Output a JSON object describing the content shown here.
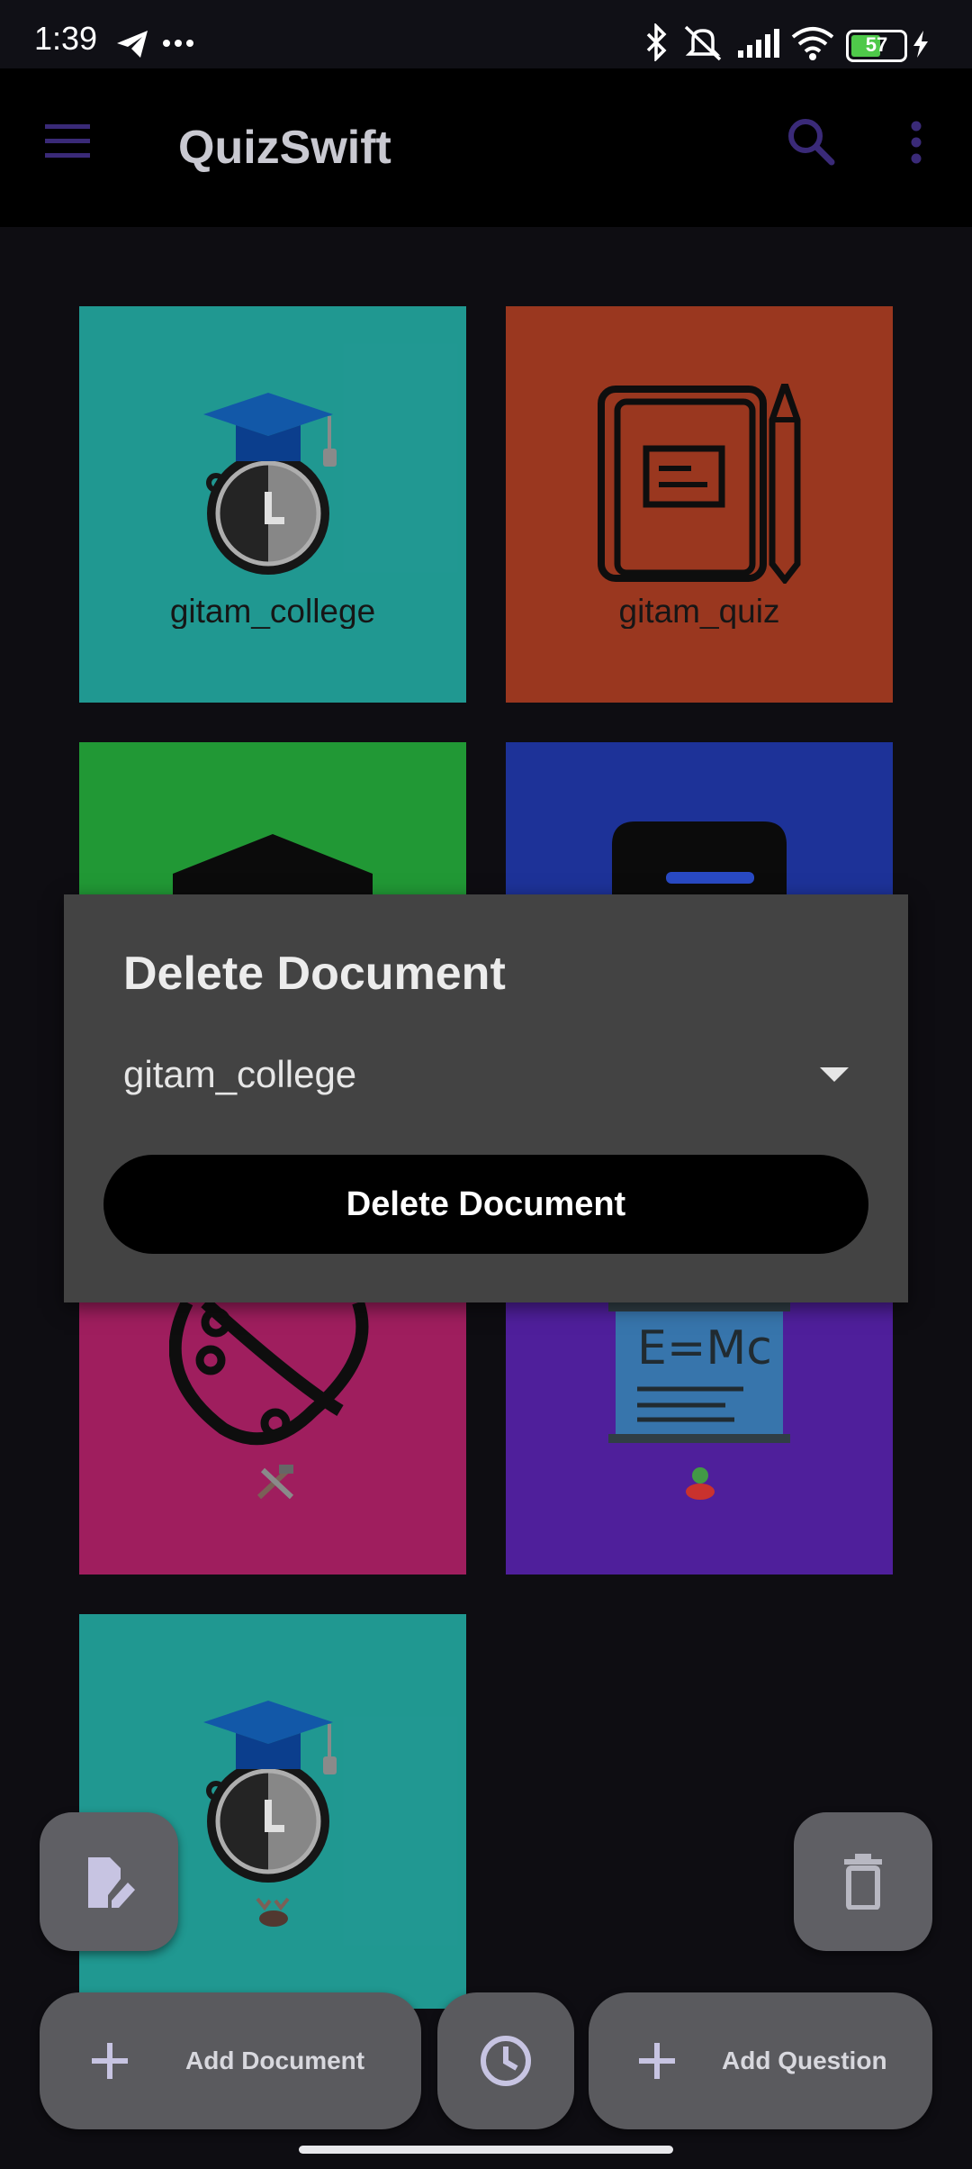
{
  "status_bar": {
    "time": "1:39",
    "battery": "57"
  },
  "app_bar": {
    "title": "QuizSwift"
  },
  "tiles": [
    {
      "label": "gitam_college",
      "color": "#25ada6"
    },
    {
      "label": "gitam_quiz",
      "color": "#b03f24"
    },
    {
      "label": "",
      "color": "#26ae3d"
    },
    {
      "label": "",
      "color": "#2239ad"
    },
    {
      "label": "",
      "color": "#b5236c"
    },
    {
      "label": "",
      "color": "#5a24b1"
    },
    {
      "label": "",
      "color": "#25ada6"
    }
  ],
  "dialog": {
    "title": "Delete Document",
    "selected_document": "gitam_college",
    "delete_label": "Delete Document"
  },
  "bottom_bar": {
    "add_document_label": "Add Document",
    "add_question_label": "Add Question"
  },
  "colors": {
    "accent": "#3a2a78",
    "fab": "#5f5f64",
    "background": "#100f15"
  }
}
